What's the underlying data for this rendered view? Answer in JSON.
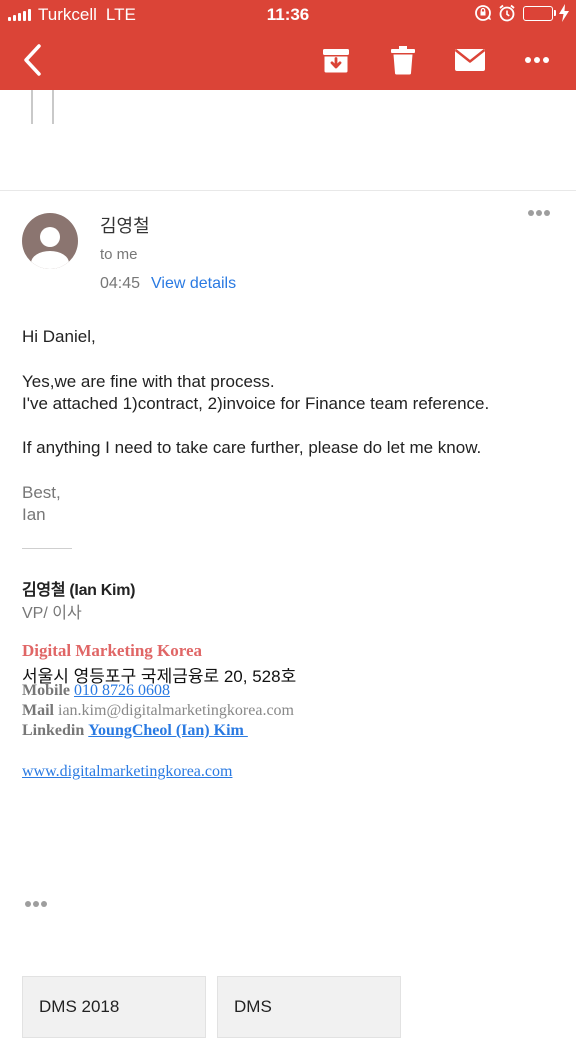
{
  "status_bar": {
    "carrier": "Turkcell",
    "network": "LTE",
    "time": "11:36",
    "battery_level": 0.2,
    "icons": [
      "signal-icon",
      "rotation-lock-icon",
      "alarm-icon",
      "battery-icon",
      "charging-icon"
    ]
  },
  "toolbar": {
    "icons": [
      "back-arrow-icon",
      "archive-icon",
      "trash-icon",
      "mail-icon",
      "more-options-icon"
    ]
  },
  "message": {
    "sender": "김영철",
    "recipient": "to me",
    "time": "04:45",
    "view_details": "View details",
    "body": {
      "greeting": "Hi Daniel,",
      "line1": "Yes,we are fine with that process.",
      "line2": "I've attached 1)contract, 2)invoice for Finance team reference.",
      "line3": "If anything I need to take care further, please do let me know.",
      "closing": "Best,",
      "name": "Ian"
    },
    "signature": {
      "name": "김영철 (Ian Kim)",
      "title": "VP/ 이사",
      "company": "Digital Marketing Korea",
      "address": "서울시 영등포구 국제금융로 20, 528호",
      "mobile_label": "Mobile",
      "mobile": "010 8726 0608",
      "mail_label": "Mail",
      "mail": "ian.kim@digitalmarketingkorea.com",
      "linkedin_label": "Linkedin",
      "linkedin": "YoungCheol (Ian) Kim ",
      "website": "www.digitalmarketingkorea.com"
    }
  },
  "attachments": [
    {
      "label": "DMS 2018"
    },
    {
      "label": "DMS"
    }
  ],
  "colors": {
    "app_bar": "#db4437",
    "link": "#2a7ae2",
    "company": "#e06666",
    "avatar": "#8b7570"
  }
}
